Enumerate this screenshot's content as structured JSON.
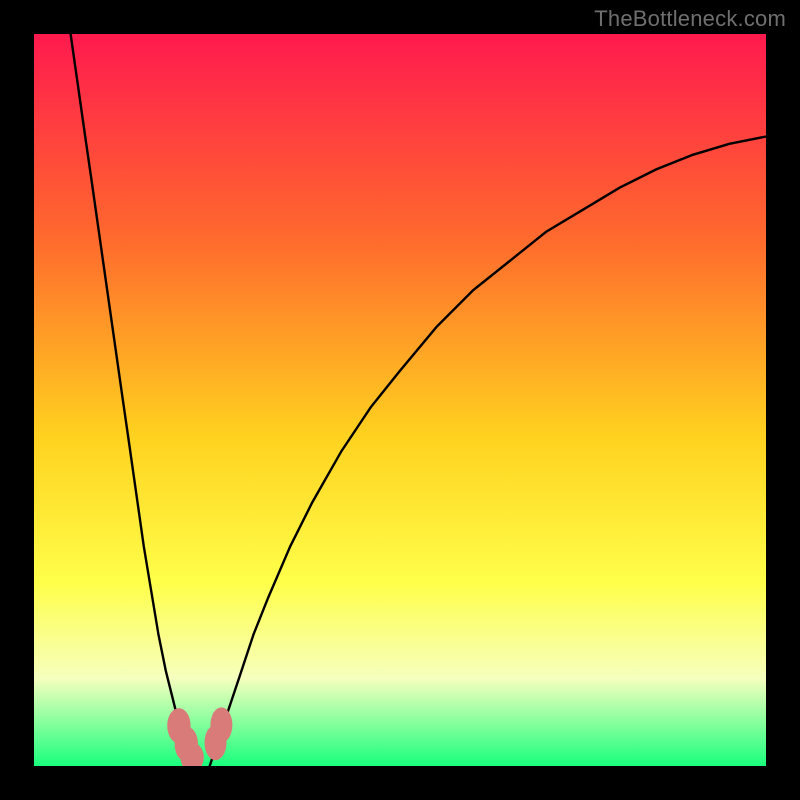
{
  "watermark": "TheBottleneck.com",
  "colors": {
    "gradient_top": "#ff1a4e",
    "gradient_mid1": "#ff6a2d",
    "gradient_mid2": "#ffd21f",
    "gradient_mid3": "#ffff4a",
    "gradient_mid4": "#f6ffbe",
    "gradient_bottom": "#19ff7d",
    "frame": "#000000",
    "curve": "#000000",
    "pink": "#d97b78"
  },
  "chart_data": {
    "type": "line",
    "title": "",
    "xlabel": "",
    "ylabel": "",
    "xlim": [
      0,
      100
    ],
    "ylim": [
      0,
      100
    ],
    "grid": false,
    "annotations": [
      "TheBottleneck.com"
    ],
    "series": [
      {
        "name": "left-curve",
        "x": [
          5,
          6,
          7,
          8,
          9,
          10,
          11,
          12,
          13,
          14,
          15,
          16,
          17,
          18,
          19,
          20,
          20.7,
          21.3,
          22
        ],
        "y": [
          100,
          93,
          86,
          79,
          72,
          65,
          58,
          51,
          44,
          37,
          30,
          24,
          18,
          13,
          9,
          5,
          3,
          1.5,
          0
        ]
      },
      {
        "name": "right-curve",
        "x": [
          24,
          25,
          26,
          28,
          30,
          32,
          35,
          38,
          42,
          46,
          50,
          55,
          60,
          65,
          70,
          75,
          80,
          85,
          90,
          95,
          100
        ],
        "y": [
          0,
          3,
          6,
          12,
          18,
          23,
          30,
          36,
          43,
          49,
          54,
          60,
          65,
          69,
          73,
          76,
          79,
          81.5,
          83.5,
          85,
          86
        ]
      }
    ],
    "markers": [
      {
        "label": "pink-left-1",
        "cx": 19.8,
        "cy": 5.5,
        "rx": 1.6,
        "ry": 2.4
      },
      {
        "label": "pink-left-2",
        "cx": 20.8,
        "cy": 3.0,
        "rx": 1.6,
        "ry": 2.4
      },
      {
        "label": "pink-left-3",
        "cx": 21.6,
        "cy": 1.2,
        "rx": 1.6,
        "ry": 2.0
      },
      {
        "label": "pink-right-1",
        "cx": 24.8,
        "cy": 3.2,
        "rx": 1.5,
        "ry": 2.4
      },
      {
        "label": "pink-right-2",
        "cx": 25.6,
        "cy": 5.6,
        "rx": 1.5,
        "ry": 2.4
      }
    ]
  }
}
